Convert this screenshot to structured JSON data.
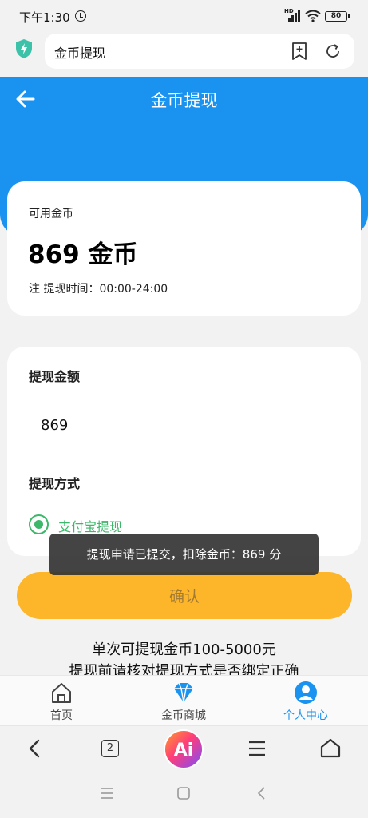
{
  "status_bar": {
    "time": "下午1:30",
    "network": "HD",
    "battery": "80"
  },
  "browser": {
    "address": "金币提现",
    "tab_count": "2",
    "ai_label": "Ai"
  },
  "header": {
    "title": "金币提现"
  },
  "balance": {
    "label": "可用金币",
    "value": "869 金币",
    "time_note": "注 提现时间：00:00-24:00"
  },
  "form": {
    "amount_label": "提现金额",
    "amount_value": "869",
    "method_label": "提现方式",
    "method_option": "支付宝提现",
    "method_selected": true
  },
  "toast": {
    "message": "提现申请已提交，扣除金币：869 分"
  },
  "confirm_button": {
    "label": "确认"
  },
  "notes": {
    "line1": "单次可提现金币100-5000元",
    "line2": "提现前请核对提现方式是否绑定正确"
  },
  "app_nav": {
    "items": [
      {
        "label": "首页",
        "icon": "home-icon",
        "active": false
      },
      {
        "label": "金币商城",
        "icon": "diamond-icon",
        "active": false
      },
      {
        "label": "个人中心",
        "icon": "user-icon",
        "active": true
      }
    ]
  },
  "colors": {
    "header_blue": "#1a92f0",
    "button_yellow": "#fdb52a",
    "radio_green": "#3bb86a",
    "active_nav_blue": "#1a92f0"
  }
}
